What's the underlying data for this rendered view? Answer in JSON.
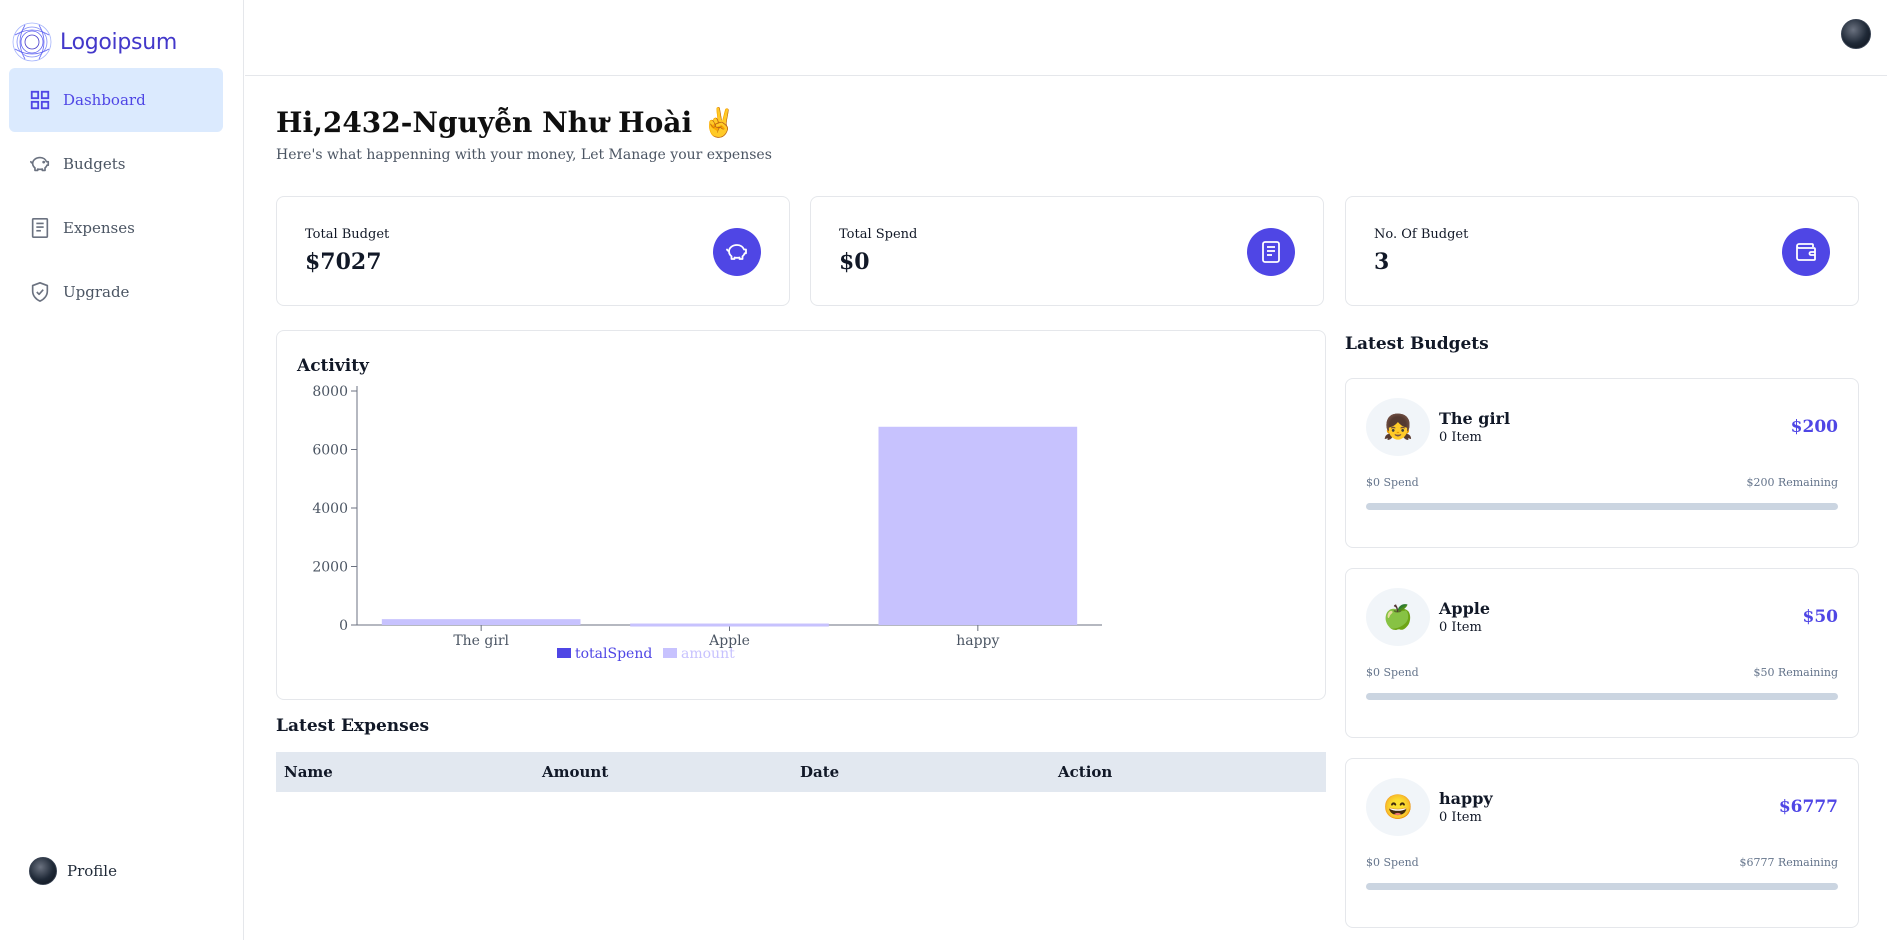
{
  "brand": {
    "name": "Logoipsum"
  },
  "sidebar": {
    "items": [
      {
        "label": "Dashboard",
        "icon": "dashboard-grid-icon",
        "active": true
      },
      {
        "label": "Budgets",
        "icon": "piggy-bank-icon",
        "active": false
      },
      {
        "label": "Expenses",
        "icon": "receipt-icon",
        "active": false
      },
      {
        "label": "Upgrade",
        "icon": "shield-check-icon",
        "active": false
      }
    ],
    "profile_label": "Profile"
  },
  "greeting": {
    "title": "Hi,2432-Nguyễn Như Hoài ✌️",
    "subtitle": "Here's what happenning with your money, Let Manage your expenses"
  },
  "stats": [
    {
      "label": "Total Budget",
      "value": "$7027",
      "icon": "piggy-bank-icon"
    },
    {
      "label": "Total Spend",
      "value": "$0",
      "icon": "receipt-icon"
    },
    {
      "label": "No. Of Budget",
      "value": "3",
      "icon": "wallet-icon"
    }
  ],
  "activity": {
    "title": "Activity"
  },
  "chart_data": {
    "type": "bar",
    "title": "Activity",
    "categories": [
      "The girl",
      "Apple",
      "happy"
    ],
    "series": [
      {
        "name": "totalSpend",
        "values": [
          0,
          0,
          0
        ],
        "color": "#4f46e5"
      },
      {
        "name": "amount",
        "values": [
          200,
          50,
          6777
        ],
        "color": "#c7c2fe"
      }
    ],
    "ylim": [
      0,
      8000
    ],
    "yticks": [
      0,
      2000,
      4000,
      6000,
      8000
    ],
    "legend": "bottom-center",
    "grid": false
  },
  "expenses": {
    "title": "Latest Expenses",
    "columns": [
      "Name",
      "Amount",
      "Date",
      "Action"
    ],
    "rows": []
  },
  "budgets": {
    "title": "Latest Budgets",
    "items": [
      {
        "emoji": "👧",
        "name": "The girl",
        "items": "0 Item",
        "amount": "$200",
        "spend": "$0 Spend",
        "remaining": "$200 Remaining",
        "progress": 0
      },
      {
        "emoji": "🍏",
        "name": "Apple",
        "items": "0 Item",
        "amount": "$50",
        "spend": "$0 Spend",
        "remaining": "$50 Remaining",
        "progress": 0
      },
      {
        "emoji": "😄",
        "name": "happy",
        "items": "0 Item",
        "amount": "$6777",
        "spend": "$0 Spend",
        "remaining": "$6777 Remaining",
        "progress": 0
      }
    ]
  },
  "colors": {
    "accent": "#4f46e5",
    "accent_light": "#c7c2fe",
    "active_nav_bg": "#dbeafe",
    "table_header_bg": "#e2e8f0"
  }
}
